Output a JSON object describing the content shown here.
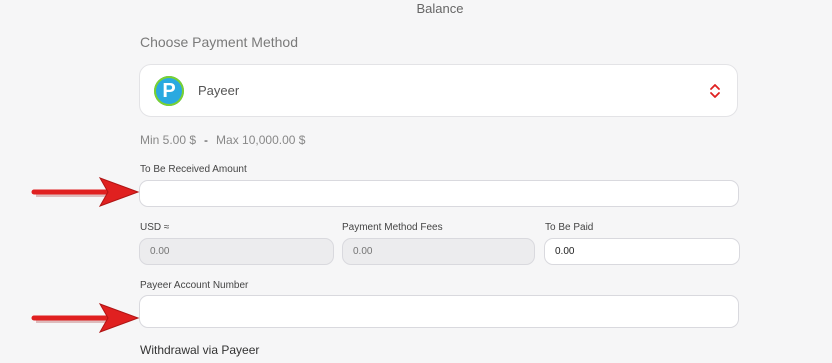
{
  "header": {
    "title": "Balance"
  },
  "payment": {
    "section_title": "Choose Payment Method",
    "selected_method": "Payeer",
    "logo_letter": "P",
    "min_label": "Min 5.00 $",
    "separator": "-",
    "max_label": "Max 10,000.00 $"
  },
  "fields": {
    "received_amount": {
      "label": "To Be Received Amount",
      "value": ""
    },
    "usd": {
      "label": "USD ≈",
      "placeholder": "0.00"
    },
    "fees": {
      "label": "Payment Method Fees",
      "placeholder": "0.00"
    },
    "to_be_paid": {
      "label": "To Be Paid",
      "value": "0.00"
    },
    "account_number": {
      "label": "Payeer Account Number",
      "value": ""
    }
  },
  "footer": {
    "title": "Withdrawal via Payeer"
  },
  "colors": {
    "arrow": "#e02020",
    "payeer_blue": "#2aa9e0",
    "payeer_green": "#7bd12f",
    "chevron": "#e02020"
  },
  "icons": [
    "payeer-logo-icon",
    "select-chevrons-icon",
    "red-arrow-icon"
  ]
}
